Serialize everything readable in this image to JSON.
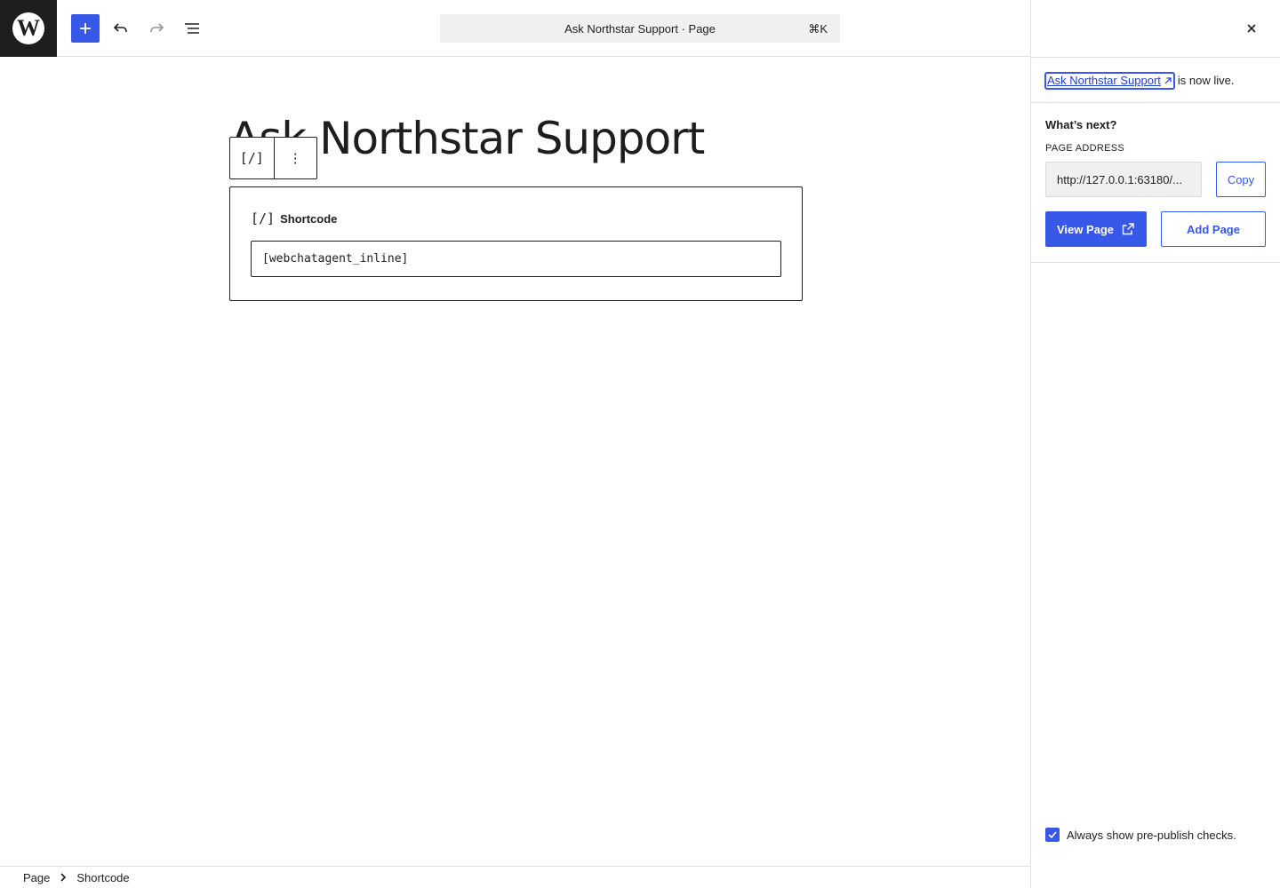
{
  "toolbar": {
    "command_bar_title": "Ask Northstar Support · Page",
    "command_bar_shortcut": "⌘K",
    "icons": {
      "logo": "wordpress-logo-icon",
      "inserter": "plus-icon",
      "undo": "undo-icon",
      "redo": "redo-icon",
      "list_view": "list-view-icon"
    }
  },
  "editor": {
    "page_title": "Ask Northstar Support",
    "block_type_icon": "[/]",
    "block_options_icon": "⋮",
    "shortcode_label": "Shortcode",
    "shortcode_icon": "[/]",
    "shortcode_value": "[webchatagent_inline]"
  },
  "sidebar": {
    "live_link_text": "Ask Northstar Support",
    "live_suffix": "is now live.",
    "whats_next": "What’s next?",
    "page_address_label": "PAGE ADDRESS",
    "page_address_value": "http://127.0.0.1:63180/...",
    "copy_label": "Copy",
    "view_page_label": "View Page",
    "add_page_label": "Add Page",
    "prepublish_label": "Always show pre-publish checks.",
    "prepublish_checked": true
  },
  "breadcrumb": {
    "items": [
      "Page",
      "Shortcode"
    ]
  },
  "colors": {
    "accent": "#3858e9",
    "text": "#1e1e1e",
    "border": "#e0e0e0",
    "field_bg": "#f0f0f0"
  }
}
